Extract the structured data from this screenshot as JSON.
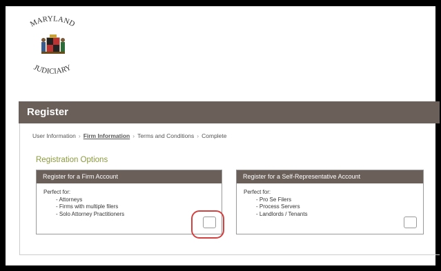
{
  "logo": {
    "top_text": "MARYLAND",
    "bottom_text": "JUDICIARY",
    "icon": "maryland-seal-icon"
  },
  "header": {
    "title": "Register"
  },
  "steps": [
    {
      "label": "User Information",
      "active": false
    },
    {
      "label": "Firm Information",
      "active": true
    },
    {
      "label": "Terms and Conditions",
      "active": false
    },
    {
      "label": "Complete",
      "active": false
    }
  ],
  "section_title": "Registration Options",
  "cards": [
    {
      "title": "Register for a Firm Account",
      "perfect_for": "Perfect for:",
      "items": [
        "- Attorneys",
        "- Firms with multiple filers",
        "- Solo Attorney Practitioners"
      ]
    },
    {
      "title": "Register for a Self-Representative Account",
      "perfect_for": "Perfect for:",
      "items": [
        "- Pro Se Filers",
        "- Process Servers",
        "- Landlords / Tenants"
      ]
    }
  ],
  "colors": {
    "header_bg": "#6b5f59",
    "accent_green": "#8a9a3c",
    "highlight_red": "#d24040"
  }
}
